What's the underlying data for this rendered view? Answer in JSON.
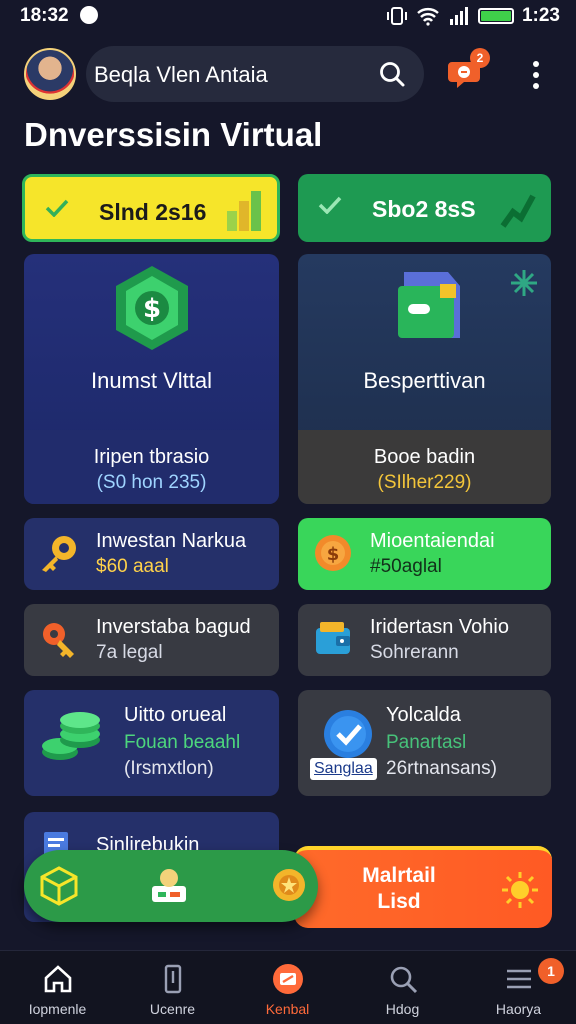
{
  "status_bar": {
    "time_left": "18:32",
    "time_right": "1:23"
  },
  "header": {
    "account_name": "Beqla Vlen Antaia",
    "chat_badge": "2"
  },
  "page_title": "Dnverssisin Virtual",
  "tabs": [
    {
      "label": "Slnd 2s16",
      "color": "#f6e52a"
    },
    {
      "label": "Sbo2 8sS",
      "color": "#1e9a52"
    }
  ],
  "big_cards": [
    {
      "title": "Inumst Vlttal",
      "sub1": "Iripen tbrasio",
      "sub2": "(S0 hon 235)"
    },
    {
      "title": "Besperttivan",
      "sub1": "Booe badin",
      "sub2": "(SIlher229)"
    }
  ],
  "small_cards": [
    {
      "l1": "Inwestan Narkua",
      "l2": "$60 aaal"
    },
    {
      "l1": "Mioentaiendai",
      "l2": "#50aglal"
    },
    {
      "l1": "Inverstaba bagud",
      "l2": "7a legal"
    },
    {
      "l1": "Iridertasn Vohio",
      "l2": "Sohrerann"
    }
  ],
  "tall_cards": [
    {
      "l1": "Uitto orueal",
      "l2": "Fouan beaahl",
      "l3": "(Irsmxtlon)"
    },
    {
      "l1": "Yolcalda",
      "l2": "Panartasl",
      "l3": "26rtnansans)",
      "tag": "Sanglaa"
    }
  ],
  "partial_card": {
    "l1": "Sinlirebukin"
  },
  "orange_card": {
    "l1": "Malrtail",
    "l2": "Lisd"
  },
  "bottom_nav": {
    "items": [
      {
        "label": "Iopmenle",
        "icon": "home-icon"
      },
      {
        "label": "Ucenre",
        "icon": "phone-icon"
      },
      {
        "label": "Kenbal",
        "icon": "wallet-icon",
        "active": true
      },
      {
        "label": "Hdog",
        "icon": "search-icon"
      },
      {
        "label": "Haorya",
        "icon": "menu-icon"
      }
    ],
    "badge": "1"
  },
  "colors": {
    "accent": "#ff6a3a",
    "lime": "#39d65a",
    "navy": "#25306a",
    "background": "#15172a"
  }
}
